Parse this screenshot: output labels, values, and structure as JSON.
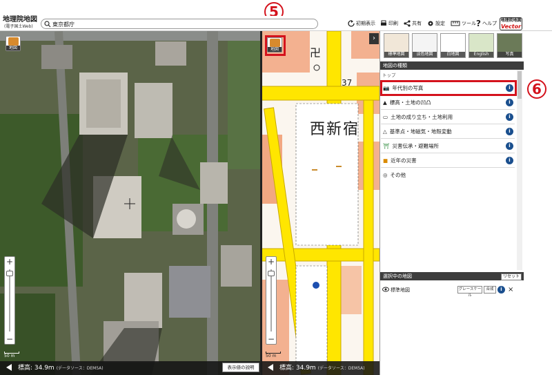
{
  "app": {
    "logo_title": "地理院地図",
    "logo_subtitle": "(電子国土Web)",
    "vector_badge_top": "地理院地図",
    "vector_badge_bottom": "Vector"
  },
  "search": {
    "value": "東京都庁"
  },
  "header_buttons": [
    {
      "label": "初期表示",
      "icon": "reset-icon"
    },
    {
      "label": "印刷",
      "icon": "print-icon"
    },
    {
      "label": "共有",
      "icon": "share-icon"
    },
    {
      "label": "設定",
      "icon": "gear-icon"
    },
    {
      "label": "ツール",
      "icon": "tool-icon"
    },
    {
      "label": "ヘルプ",
      "icon": "help-icon"
    }
  ],
  "left_map": {
    "switch_label": "地図",
    "zoom_plus": "+",
    "zoom_minus": "−",
    "scale_label": "50 m",
    "elevation_text": "標高: 34.9m",
    "source_text": "(データソース：DEM5A)",
    "explain_button": "表示値の説明"
  },
  "right_map": {
    "switch_label": "地図",
    "zoom_plus": "+",
    "zoom_minus": "−",
    "scale_label": "50 m",
    "elevation_text": "標高: 34.9m",
    "source_text": "(データソース：DEM5A)",
    "label_area": "西新宿",
    "label_number": "37"
  },
  "callouts": {
    "five": "5",
    "six": "6"
  },
  "panel": {
    "toggle": "›",
    "thumbnails": [
      {
        "label": "標準地図"
      },
      {
        "label": "淡色地図"
      },
      {
        "label": "白地図"
      },
      {
        "label": "English"
      },
      {
        "label": "写真"
      }
    ],
    "map_types_header": "地図の種類",
    "breadcrumb": "トップ",
    "categories": [
      {
        "label": "年代別の写真",
        "icon": "camera-icon"
      },
      {
        "label": "標高・土地の凹凸",
        "icon": "mountain-icon"
      },
      {
        "label": "土地の成り立ち・土地利用",
        "icon": "land-icon"
      },
      {
        "label": "基準点・地磁気・地殻変動",
        "icon": "triangle-icon"
      },
      {
        "label": "災害伝承・避難場所",
        "icon": "evacuation-icon"
      },
      {
        "label": "近年の災害",
        "icon": "disaster-icon"
      },
      {
        "label": "その他",
        "icon": "other-icon"
      }
    ],
    "info_glyph": "i",
    "selected_header": "選択中の地図",
    "reset_button": "リセット",
    "selected_maps": [
      {
        "name": "標準地図",
        "grayscale_button": "グレースケール",
        "merge_button": "合成"
      }
    ],
    "close_glyph": "×"
  },
  "colors": {
    "highlight": "#d4121c",
    "info": "#1a4f8e",
    "road_yellow": "#ffe600"
  }
}
